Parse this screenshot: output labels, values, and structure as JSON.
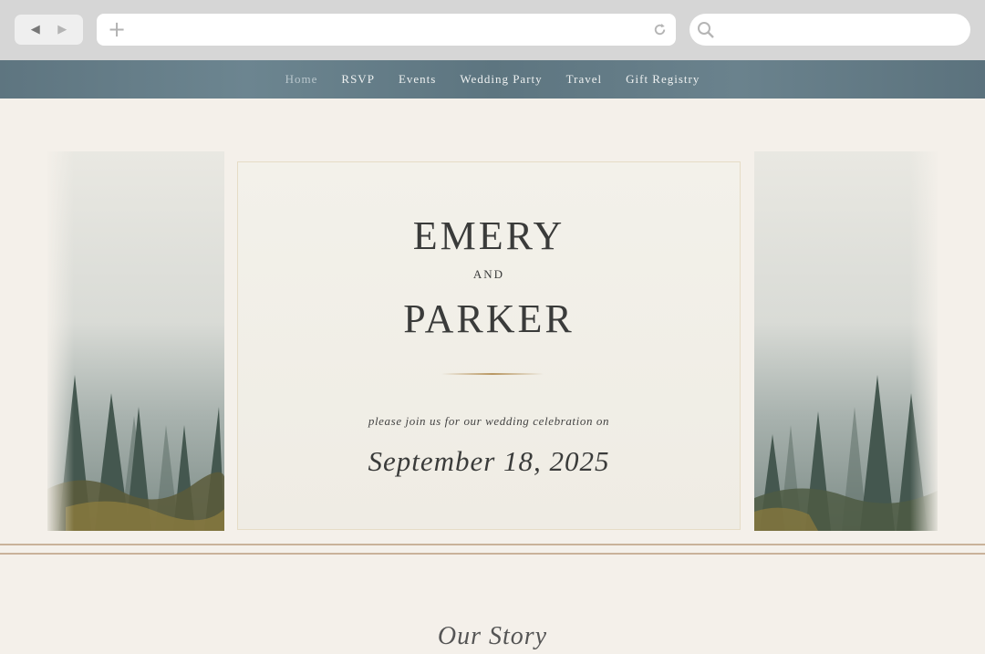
{
  "browser": {
    "back_icon": "back-arrow-icon",
    "forward_icon": "forward-arrow-icon",
    "new_tab_icon": "plus-icon",
    "reload_icon": "reload-icon",
    "search_icon": "search-icon"
  },
  "nav": {
    "items": [
      {
        "label": "Home",
        "active": true
      },
      {
        "label": "RSVP"
      },
      {
        "label": "Events"
      },
      {
        "label": "Wedding Party"
      },
      {
        "label": "Travel"
      },
      {
        "label": "Gift Registry"
      }
    ],
    "color": "#607884"
  },
  "hero": {
    "name1": "EMERY",
    "and": "AND",
    "name2": "PARKER",
    "invite": "please join us for our wedding celebration on",
    "date": "September 18, 2025"
  },
  "story": {
    "title": "Our Story"
  },
  "colors": {
    "accent_gold": "#b99762",
    "page_bg": "#f4f0ea",
    "forest": "#465a52"
  }
}
